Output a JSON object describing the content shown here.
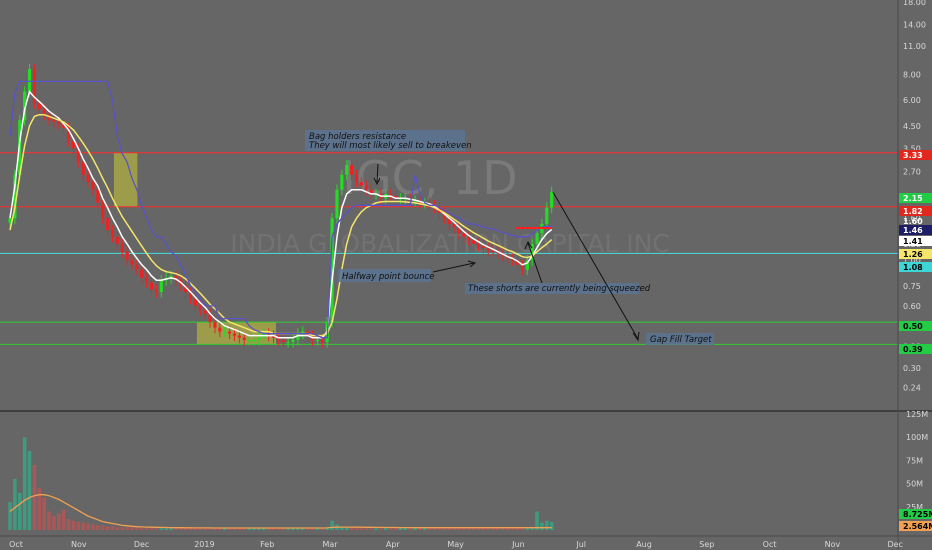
{
  "chart_data": {
    "type": "candlestick",
    "watermark": {
      "symbol": "IGC, 1D",
      "company": "INDIA GLOBALIZATION CAPITAL INC"
    },
    "price_axis": {
      "scale": "log",
      "ticks": [
        "18.00",
        "14.00",
        "11.00",
        "8.00",
        "6.00",
        "4.50",
        "3.50",
        "2.70",
        "2.00",
        "1.60",
        "1.20",
        "1.00",
        "0.75",
        "0.60",
        "0.48",
        "0.38",
        "0.30",
        "0.24"
      ]
    },
    "volume_axis": {
      "ticks": [
        "125M",
        "100M",
        "75M",
        "50M",
        "25M"
      ],
      "max": 125
    },
    "time_axis": {
      "labels": [
        "Oct",
        "Nov",
        "Dec",
        "2019",
        "Feb",
        "Mar",
        "Apr",
        "May",
        "Jun",
        "Jul",
        "Aug",
        "Sep",
        "Oct",
        "Nov",
        "Dec"
      ]
    },
    "price_tags": [
      {
        "label": "3.33",
        "value": 3.33,
        "bg": "#e0281f",
        "fg": "#ffffff"
      },
      {
        "label": "2.15",
        "value": 2.15,
        "bg": "#22cc44",
        "fg": "#ffffff"
      },
      {
        "label": "1.82",
        "value": 1.82,
        "bg": "#e0281f",
        "fg": "#ffffff"
      },
      {
        "label": "1.60",
        "value": 1.6,
        "bg": "none",
        "fg": "#ffffff"
      },
      {
        "label": "1.46",
        "value": 1.46,
        "bg": "#1e1e66",
        "fg": "#ffffff"
      },
      {
        "label": "1.41",
        "value": 1.41,
        "bg": "#ffffff",
        "fg": "#000000"
      },
      {
        "label": "1.26",
        "value": 1.26,
        "bg": "#f5e66a",
        "fg": "#000000"
      },
      {
        "label": "1.08",
        "value": 1.08,
        "bg": "#3dd6d6",
        "fg": "#000000"
      },
      {
        "label": "0.50",
        "value": 0.5,
        "bg": "#22cc44",
        "fg": "#000000"
      },
      {
        "label": "0.39",
        "value": 0.39,
        "bg": "#22cc44",
        "fg": "#000000"
      }
    ],
    "volume_tags": [
      {
        "label": "8.725M",
        "value": 8.725,
        "bg": "#22cc44",
        "fg": "#000000"
      },
      {
        "label": "2.564M",
        "value": 2.564,
        "bg": "#f0a050",
        "fg": "#000000"
      }
    ],
    "horizontal_levels": [
      {
        "value": 3.33,
        "color": "#ff2a2a"
      },
      {
        "value": 1.82,
        "color": "#ff2a2a"
      },
      {
        "value": 1.08,
        "color": "#40e0e0"
      },
      {
        "value": 0.5,
        "color": "#30d030"
      },
      {
        "value": 0.39,
        "color": "#30d030"
      }
    ],
    "zones": [
      {
        "t0": 21.3,
        "t1": 26.1,
        "top": 3.33,
        "bottom": 1.82
      },
      {
        "t0": 38.3,
        "t1": 54.5,
        "top": 0.5,
        "bottom": 0.39
      }
    ],
    "annotations": [
      "Bag holders resistance",
      "They will most likely sell to breakeven",
      "Halfway point bounce",
      "These shorts are currently being squeezed",
      "Gap Fill Target"
    ],
    "series": [
      {
        "name": "close",
        "values": [
          1.6,
          2.6,
          4.8,
          6.6,
          8.5,
          5.8,
          5.4,
          5.1,
          4.8,
          4.7,
          4.6,
          4.4,
          3.8,
          3.5,
          3.0,
          2.6,
          2.4,
          2.2,
          1.9,
          1.6,
          1.4,
          1.3,
          1.2,
          1.1,
          1.0,
          0.95,
          0.9,
          0.82,
          0.78,
          0.72,
          0.7,
          0.8,
          0.82,
          0.84,
          0.8,
          0.75,
          0.7,
          0.65,
          0.6,
          0.57,
          0.55,
          0.5,
          0.47,
          0.45,
          0.45,
          0.44,
          0.43,
          0.42,
          0.41,
          0.41,
          0.41,
          0.42,
          0.44,
          0.43,
          0.42,
          0.41,
          0.4,
          0.4,
          0.41,
          0.44,
          0.45,
          0.43,
          0.41,
          0.41,
          0.4,
          0.5,
          1.6,
          2.2,
          2.6,
          2.9,
          2.6,
          2.4,
          2.3,
          2.2,
          2.1,
          2.1,
          2.0,
          2.1,
          2.05,
          2.0,
          2.0,
          2.0,
          1.95,
          1.95,
          1.9,
          1.9,
          1.85,
          1.8,
          1.7,
          1.6,
          1.5,
          1.45,
          1.35,
          1.3,
          1.25,
          1.2,
          1.18,
          1.15,
          1.12,
          1.1,
          1.08,
          1.05,
          1.02,
          1.0,
          0.95,
          0.9,
          1.0,
          1.2,
          1.35,
          1.5,
          1.8,
          2.15
        ]
      },
      {
        "name": "ema_fast",
        "values": [
          1.6,
          2.3,
          3.8,
          5.4,
          6.6,
          6.2,
          5.9,
          5.6,
          5.3,
          5.1,
          4.9,
          4.6,
          4.3,
          3.9,
          3.5,
          3.1,
          2.8,
          2.5,
          2.3,
          2.0,
          1.8,
          1.6,
          1.45,
          1.3,
          1.2,
          1.1,
          1.02,
          0.95,
          0.9,
          0.84,
          0.8,
          0.8,
          0.81,
          0.82,
          0.81,
          0.78,
          0.74,
          0.7,
          0.66,
          0.62,
          0.59,
          0.55,
          0.52,
          0.5,
          0.48,
          0.47,
          0.46,
          0.45,
          0.44,
          0.43,
          0.43,
          0.43,
          0.43,
          0.43,
          0.43,
          0.42,
          0.42,
          0.42,
          0.42,
          0.43,
          0.43,
          0.43,
          0.42,
          0.42,
          0.42,
          0.45,
          0.8,
          1.3,
          1.8,
          2.1,
          2.2,
          2.2,
          2.2,
          2.15,
          2.1,
          2.1,
          2.05,
          2.05,
          2.05,
          2.0,
          2.0,
          2.0,
          1.98,
          1.96,
          1.93,
          1.9,
          1.88,
          1.83,
          1.75,
          1.68,
          1.6,
          1.53,
          1.45,
          1.38,
          1.32,
          1.27,
          1.23,
          1.19,
          1.16,
          1.13,
          1.1,
          1.07,
          1.04,
          1.02,
          0.99,
          0.95,
          0.97,
          1.05,
          1.15,
          1.26,
          1.35,
          1.41
        ]
      },
      {
        "name": "ema_slow",
        "values": [
          1.4,
          1.8,
          2.6,
          3.6,
          4.5,
          5.0,
          5.1,
          5.1,
          5.0,
          4.9,
          4.8,
          4.7,
          4.5,
          4.3,
          4.0,
          3.7,
          3.4,
          3.1,
          2.8,
          2.5,
          2.25,
          2.0,
          1.8,
          1.63,
          1.5,
          1.38,
          1.27,
          1.17,
          1.08,
          1.0,
          0.94,
          0.9,
          0.88,
          0.87,
          0.86,
          0.84,
          0.81,
          0.77,
          0.73,
          0.69,
          0.65,
          0.61,
          0.58,
          0.55,
          0.52,
          0.5,
          0.49,
          0.48,
          0.47,
          0.46,
          0.45,
          0.45,
          0.45,
          0.45,
          0.44,
          0.44,
          0.44,
          0.44,
          0.44,
          0.44,
          0.44,
          0.44,
          0.43,
          0.43,
          0.43,
          0.44,
          0.5,
          0.65,
          0.9,
          1.2,
          1.45,
          1.6,
          1.72,
          1.8,
          1.85,
          1.9,
          1.92,
          1.93,
          1.93,
          1.93,
          1.93,
          1.92,
          1.91,
          1.9,
          1.88,
          1.86,
          1.84,
          1.8,
          1.75,
          1.7,
          1.64,
          1.58,
          1.52,
          1.46,
          1.41,
          1.36,
          1.32,
          1.28,
          1.24,
          1.21,
          1.18,
          1.15,
          1.12,
          1.1,
          1.07,
          1.04,
          1.03,
          1.05,
          1.1,
          1.15,
          1.2,
          1.26
        ]
      },
      {
        "name": "trailing_stop",
        "values": [
          4.0,
          6.5,
          7.4,
          7.4,
          7.4,
          7.4,
          7.4,
          7.4,
          7.4,
          7.4,
          7.4,
          7.4,
          7.4,
          7.4,
          7.4,
          7.4,
          7.4,
          7.4,
          7.4,
          7.4,
          7.4,
          6.0,
          4.0,
          3.3,
          3.0,
          2.5,
          2.2,
          1.85,
          1.6,
          1.4,
          1.3,
          1.3,
          1.2,
          1.1,
          1.05,
          0.95,
          0.85,
          0.75,
          0.7,
          0.65,
          0.6,
          0.6,
          0.6,
          0.52,
          0.52,
          0.52,
          0.52,
          0.52,
          0.52,
          0.48,
          0.46,
          0.45,
          0.44,
          0.44,
          0.44,
          0.44,
          0.44,
          0.44,
          0.44,
          0.44,
          0.44,
          0.44,
          0.44,
          0.43,
          0.42,
          0.42,
          1.3,
          1.5,
          1.6,
          1.7,
          1.8,
          1.85,
          1.85,
          1.85,
          1.85,
          1.85,
          1.85,
          1.85,
          1.85,
          1.85,
          1.85,
          1.85,
          1.85,
          2.6,
          2.1,
          1.9,
          1.85,
          1.85,
          1.8,
          1.75,
          1.7,
          1.65,
          1.6,
          1.55,
          1.5,
          1.5,
          1.48,
          1.45,
          1.43,
          1.42,
          1.4,
          1.36,
          1.34,
          1.32,
          1.3,
          1.3,
          1.3,
          1.34,
          1.4,
          1.45,
          1.46,
          1.46
        ]
      }
    ],
    "volume": {
      "values": [
        30,
        55,
        40,
        100,
        85,
        70,
        45,
        35,
        20,
        15,
        18,
        22,
        12,
        10,
        9,
        8,
        7,
        6,
        5,
        5,
        4,
        4,
        3,
        3,
        3,
        3,
        3,
        2,
        2,
        2,
        2,
        2,
        2,
        2,
        2,
        2,
        2,
        2,
        2,
        2,
        2,
        2,
        2,
        2,
        2,
        2,
        2,
        2,
        2,
        2,
        2,
        2,
        2,
        2,
        2,
        2,
        2,
        2,
        2,
        2,
        2,
        2,
        2,
        2,
        2,
        3,
        10,
        6,
        4,
        3,
        3,
        2,
        2,
        2,
        2,
        2,
        2,
        2,
        2,
        2,
        2,
        2,
        2,
        2,
        2,
        2,
        2,
        2,
        2,
        2,
        2,
        2,
        2,
        3,
        2,
        2,
        2,
        2,
        2,
        2,
        2,
        2,
        2,
        2,
        2,
        2,
        2,
        3,
        20,
        8,
        10,
        8.725
      ],
      "ma": [
        20,
        24,
        28,
        32,
        35,
        37,
        38,
        38,
        37,
        35,
        33,
        30,
        27,
        24,
        21,
        18,
        15,
        13,
        11,
        9,
        8,
        7,
        6,
        5,
        4.5,
        4,
        3.6,
        3.3,
        3.1,
        3,
        2.9,
        2.8,
        2.7,
        2.6,
        2.5,
        2.5,
        2.4,
        2.4,
        2.3,
        2.3,
        2.3,
        2.3,
        2.2,
        2.2,
        2.2,
        2.2,
        2.2,
        2.2,
        2.2,
        2.2,
        2.2,
        2.2,
        2.2,
        2.2,
        2.2,
        2.2,
        2.2,
        2.2,
        2.2,
        2.2,
        2.2,
        2.2,
        2.2,
        2.2,
        2.2,
        2.3,
        2.8,
        3.0,
        3.1,
        3.1,
        3.1,
        3.0,
        3.0,
        2.9,
        2.9,
        2.8,
        2.8,
        2.7,
        2.7,
        2.7,
        2.6,
        2.6,
        2.6,
        2.5,
        2.5,
        2.5,
        2.5,
        2.5,
        2.5,
        2.5,
        2.5,
        2.5,
        2.5,
        2.5,
        2.5,
        2.5,
        2.5,
        2.5,
        2.5,
        2.5,
        2.5,
        2.5,
        2.5,
        2.5,
        2.5,
        2.5,
        2.5,
        2.5,
        2.5,
        2.5,
        2.5,
        2.564
      ]
    }
  }
}
